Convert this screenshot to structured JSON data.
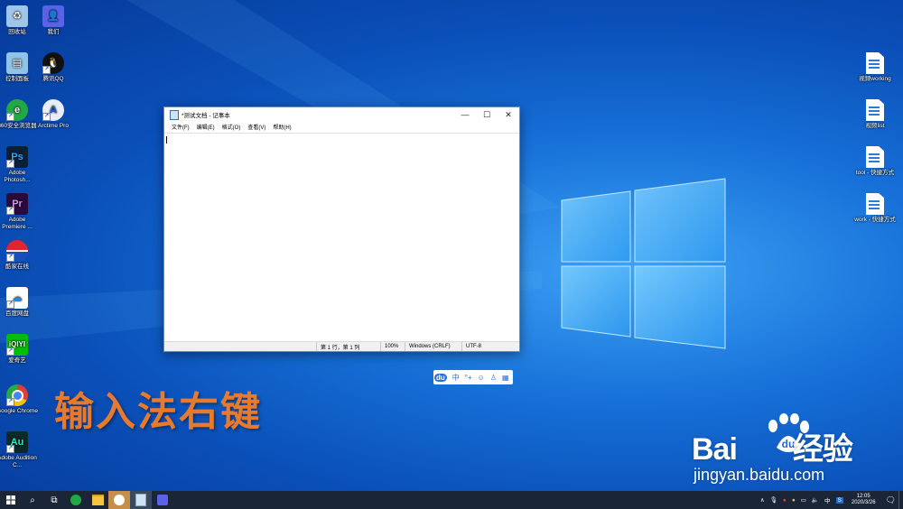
{
  "desktop": {
    "icons_left": [
      {
        "label": "回收站",
        "icon": "recycle-bin-icon"
      },
      {
        "label": "我们",
        "icon": "user-app-icon"
      },
      {
        "label": "控制面板",
        "icon": "control-panel-icon"
      },
      {
        "label": "腾讯QQ",
        "icon": "qq-penguin-icon"
      },
      {
        "label": "360安全浏览器",
        "icon": "360-browser-icon"
      },
      {
        "label": "Arctime Pro",
        "icon": "arctime-icon"
      },
      {
        "label": "Adobe Photosh...",
        "icon": "photoshop-icon"
      },
      {
        "label": "Adobe Premiere ...",
        "icon": "premiere-icon"
      },
      {
        "label": "酷家在线",
        "icon": "pepsi-icon"
      },
      {
        "label": "百度网盘",
        "icon": "baidu-netdisk-icon"
      },
      {
        "label": "爱奇艺",
        "icon": "iqiyi-icon"
      },
      {
        "label": "Google Chrome",
        "icon": "chrome-icon"
      },
      {
        "label": "Adobe Audition C...",
        "icon": "audition-icon"
      }
    ],
    "icons_right": [
      {
        "label": "视频working"
      },
      {
        "label": "视频list"
      },
      {
        "label": "tool - 快捷方式"
      },
      {
        "label": "work - 快捷方式"
      }
    ]
  },
  "notepad": {
    "title": "*测试文档 - 记事本",
    "menu": [
      "文件(F)",
      "编辑(E)",
      "格式(O)",
      "查看(V)",
      "帮助(H)"
    ],
    "status": {
      "position": "第 1 行，第 1 列",
      "zoom": "100%",
      "line_ending": "Windows (CRLF)",
      "encoding": "UTF-8"
    }
  },
  "ime": {
    "brand": "du",
    "mode": "中",
    "items": [
      "°+",
      "☺",
      "♙",
      "▦"
    ]
  },
  "caption": "输入法右键",
  "watermark": {
    "brand_left": "Bai",
    "brand_right": "经验",
    "url": "jingyan.baidu.com"
  },
  "taskbar": {
    "clock_time": "12:05",
    "clock_date": "2020/3/26",
    "tray_lang": "中",
    "tray_ime": "S"
  },
  "colors": {
    "accent": "#0a63d8",
    "caption": "#e87a2e",
    "taskbar": "#1a2637"
  }
}
